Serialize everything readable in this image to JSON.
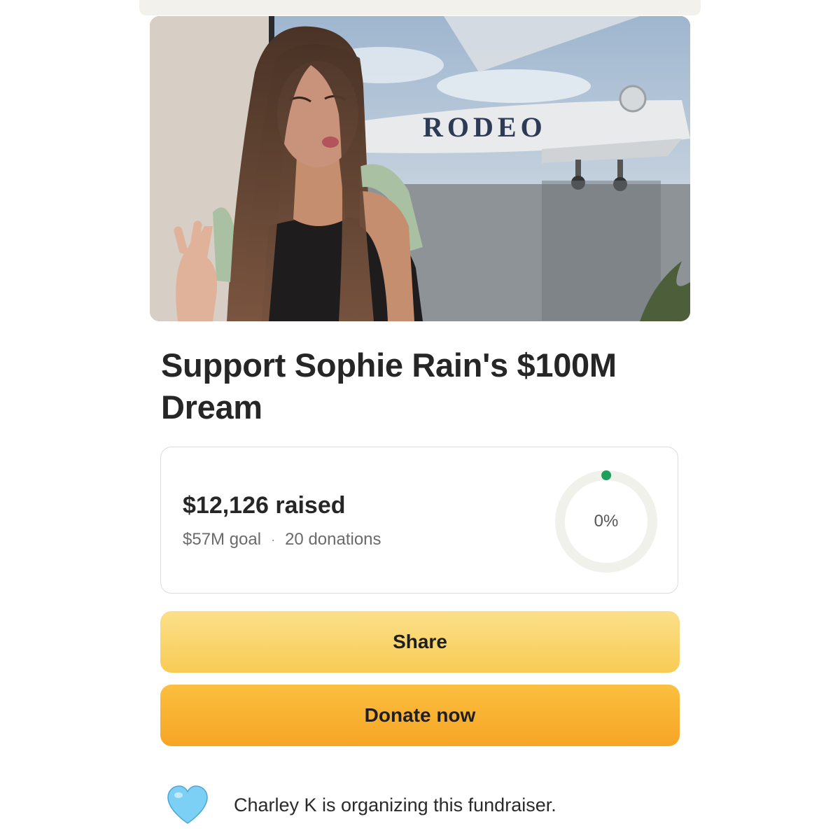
{
  "hero_image": {
    "alt": "Photo of a woman in front of a private jet",
    "jet_text": "RODEO"
  },
  "fundraiser": {
    "title": "Support Sophie Rain's $100M Dream",
    "raised_text": "$12,126 raised",
    "goal_text": "$57M goal",
    "separator": "·",
    "donations_text": "20 donations",
    "progress_label": "0%",
    "progress_fraction": 0.0002,
    "progress_color": "#1ea05b",
    "ring_track_color": "#f1f1ec"
  },
  "actions": {
    "share_label": "Share",
    "donate_label": "Donate now"
  },
  "organizer": {
    "icon": "blue-heart-icon",
    "text": "Charley K is organizing this fundraiser."
  },
  "colors": {
    "share_button": "#f8cb55",
    "donate_button": "#f7a525",
    "heart": "#7ccff5"
  }
}
